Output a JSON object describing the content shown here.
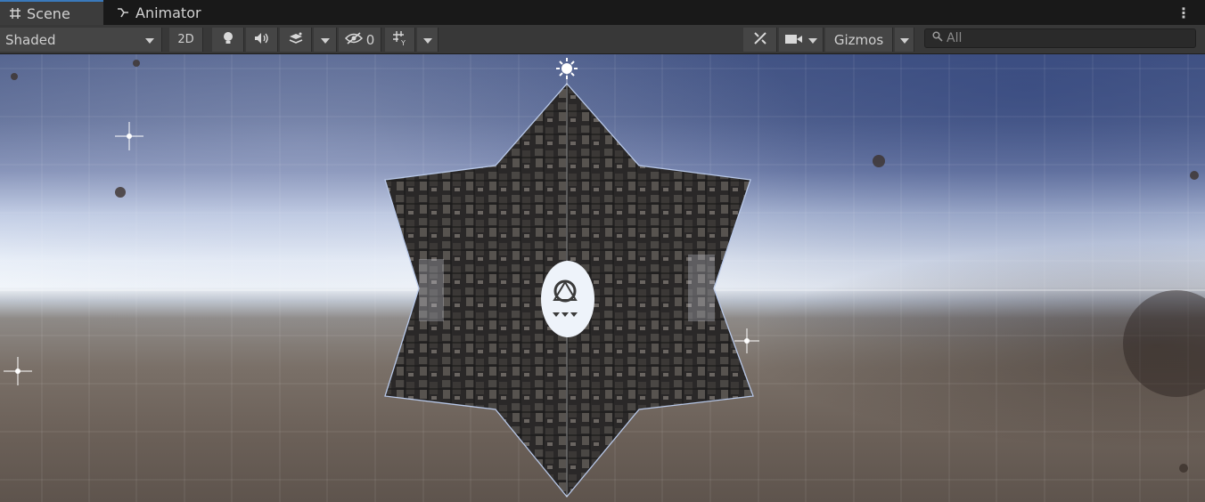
{
  "tabs": [
    {
      "label": "Scene",
      "icon": "grid-hash-icon",
      "active": true
    },
    {
      "label": "Animator",
      "icon": "animator-icon",
      "active": false
    }
  ],
  "toolbar": {
    "draw_mode": "Shaded",
    "mode_2d": "2D",
    "hidden_count": "0",
    "gizmos_label": "Gizmos"
  },
  "search": {
    "placeholder": "All"
  },
  "colors": {
    "tab_accent": "#3a79bb",
    "toolbar_bg": "#383838",
    "tab_bg": "#191919"
  }
}
